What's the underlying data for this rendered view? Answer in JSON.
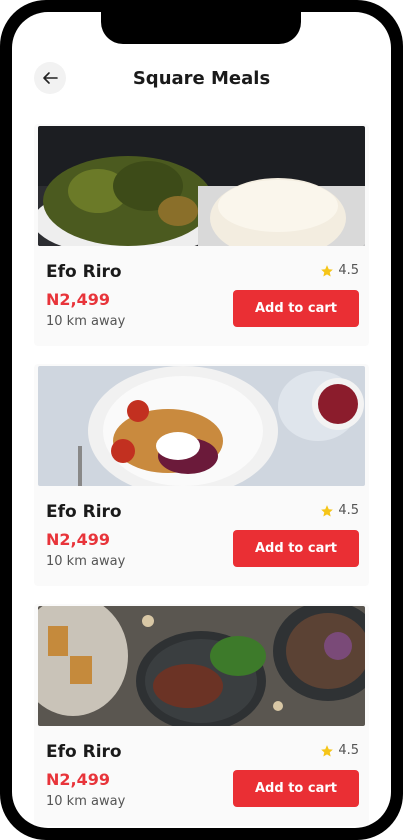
{
  "header": {
    "title": "Square Meals"
  },
  "icons": {
    "back": "arrow-left-icon",
    "rating": "star-icon"
  },
  "colors": {
    "accent": "#ea2f34",
    "price": "#e8343a",
    "star": "#f5c518"
  },
  "meals": [
    {
      "name": "Efo Riro",
      "price": "N2,499",
      "distance": "10 km away",
      "rating": "4.5",
      "cart_label": "Add to cart"
    },
    {
      "name": "Efo Riro",
      "price": "N2,499",
      "distance": "10 km away",
      "rating": "4.5",
      "cart_label": "Add to cart"
    },
    {
      "name": "Efo Riro",
      "price": "N2,499",
      "distance": "10 km away",
      "rating": "4.5",
      "cart_label": "Add to cart"
    }
  ]
}
